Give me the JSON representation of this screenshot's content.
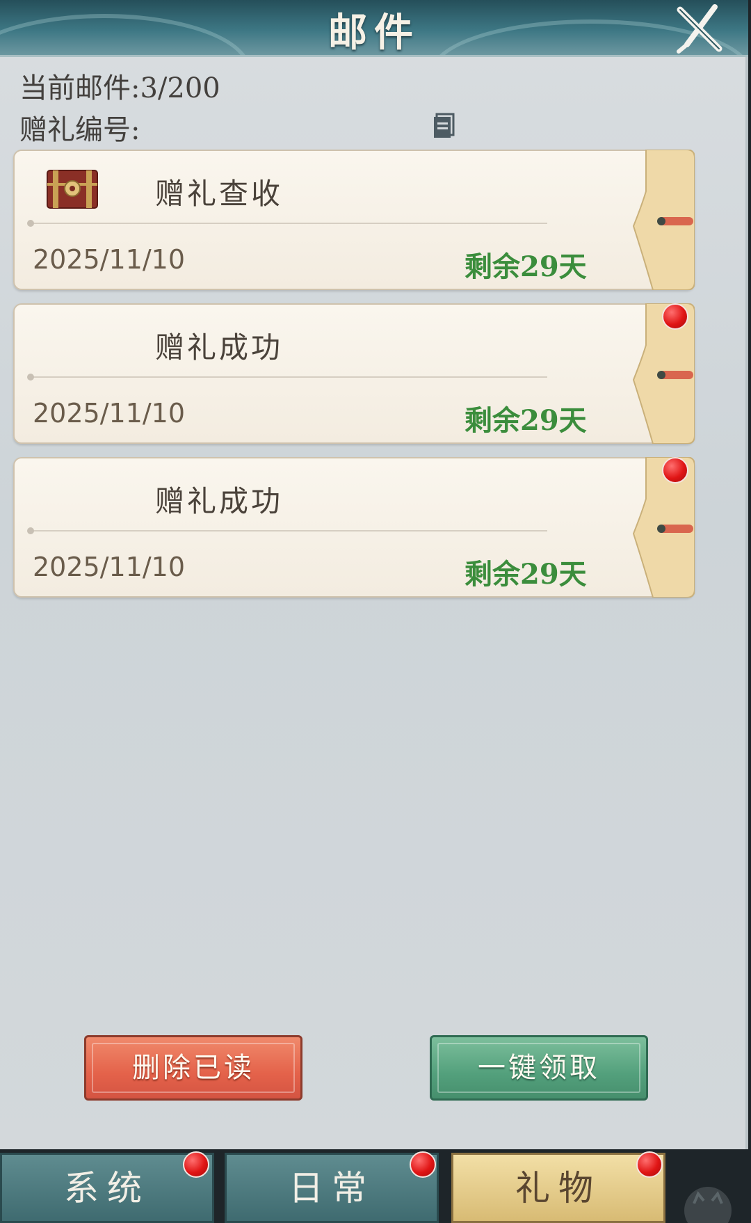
{
  "window": {
    "title": "邮件"
  },
  "info": {
    "count_label": "当前邮件:3/200",
    "gift_id_label": "赠礼编号:"
  },
  "mails": [
    {
      "subject": "赠礼查收",
      "date": "2025/11/10",
      "remaining": "剩余29天",
      "icon": "treasure-chest-icon",
      "unread": false
    },
    {
      "subject": "赠礼成功",
      "date": "2025/11/10",
      "remaining": "剩余29天",
      "icon": "",
      "unread": true
    },
    {
      "subject": "赠礼成功",
      "date": "2025/11/10",
      "remaining": "剩余29天",
      "icon": "",
      "unread": true
    }
  ],
  "actions": {
    "delete_read": "删除已读",
    "claim_all": "一键领取"
  },
  "tabs": [
    {
      "label": "系统",
      "active": false,
      "badge": true
    },
    {
      "label": "日常",
      "active": false,
      "badge": true
    },
    {
      "label": "礼物",
      "active": true,
      "badge": true
    }
  ],
  "colors": {
    "remaining_text": "#3b8d3c",
    "badge": "#e01515",
    "delete_button": "#e4624a",
    "claim_button": "#53a07c",
    "active_tab": "#d8bb74",
    "inactive_tab": "#3f6b70"
  }
}
